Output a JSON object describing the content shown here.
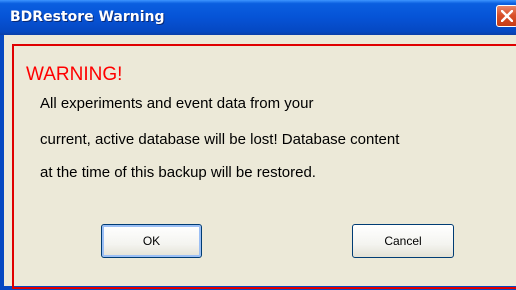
{
  "window": {
    "title": "BDRestore Warning",
    "close_icon": "close-icon"
  },
  "dialog": {
    "heading": "WARNING!",
    "message_lines": [
      "All experiments and event data from your",
      "current, active database will be lost!  Database content",
      "at the time of this backup will be restored."
    ],
    "buttons": {
      "ok_label": "OK",
      "cancel_label": "Cancel"
    }
  },
  "colors": {
    "titlebar": "#0653d6",
    "client_background": "#ece9d8",
    "warning_red": "#ff0000",
    "close_button": "#d9512a"
  }
}
